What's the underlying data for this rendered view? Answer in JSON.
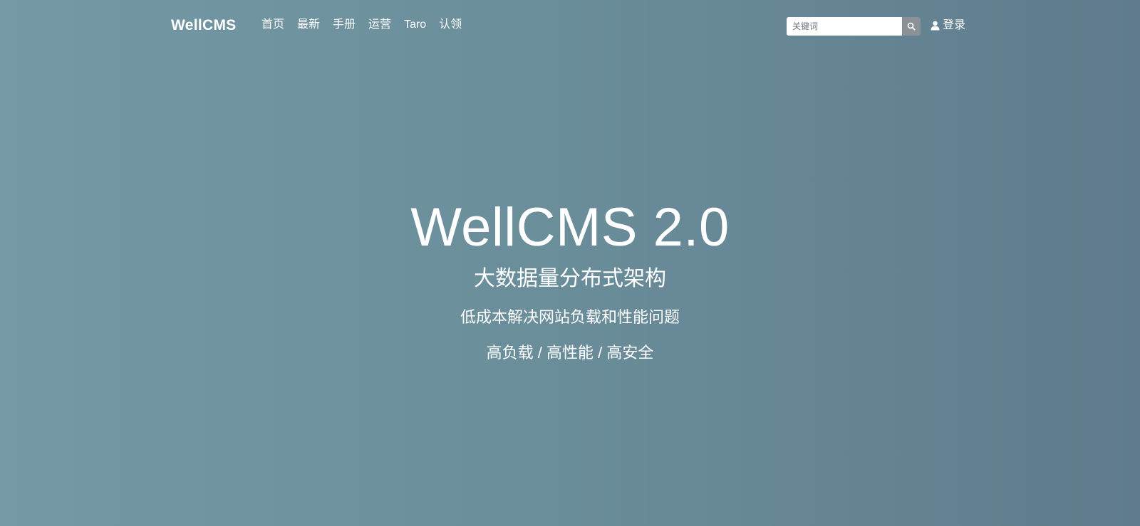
{
  "navbar": {
    "logo": "WellCMS",
    "links": [
      {
        "label": "首页"
      },
      {
        "label": "最新"
      },
      {
        "label": "手册"
      },
      {
        "label": "运营"
      },
      {
        "label": "Taro"
      },
      {
        "label": "认领"
      }
    ],
    "search": {
      "placeholder": "关键词",
      "icon": "search-icon"
    },
    "login": {
      "label": "登录",
      "icon": "user-icon"
    }
  },
  "hero": {
    "title": "WellCMS 2.0",
    "subtitle": "大数据量分布式架构",
    "description": "低成本解决网站负载和性能问题",
    "tags": "高负载 / 高性能 / 高安全"
  },
  "colors": {
    "background_start": "#7599a6",
    "background_end": "#5f7b8d",
    "text": "#ffffff",
    "search_button": "#8a9197"
  }
}
